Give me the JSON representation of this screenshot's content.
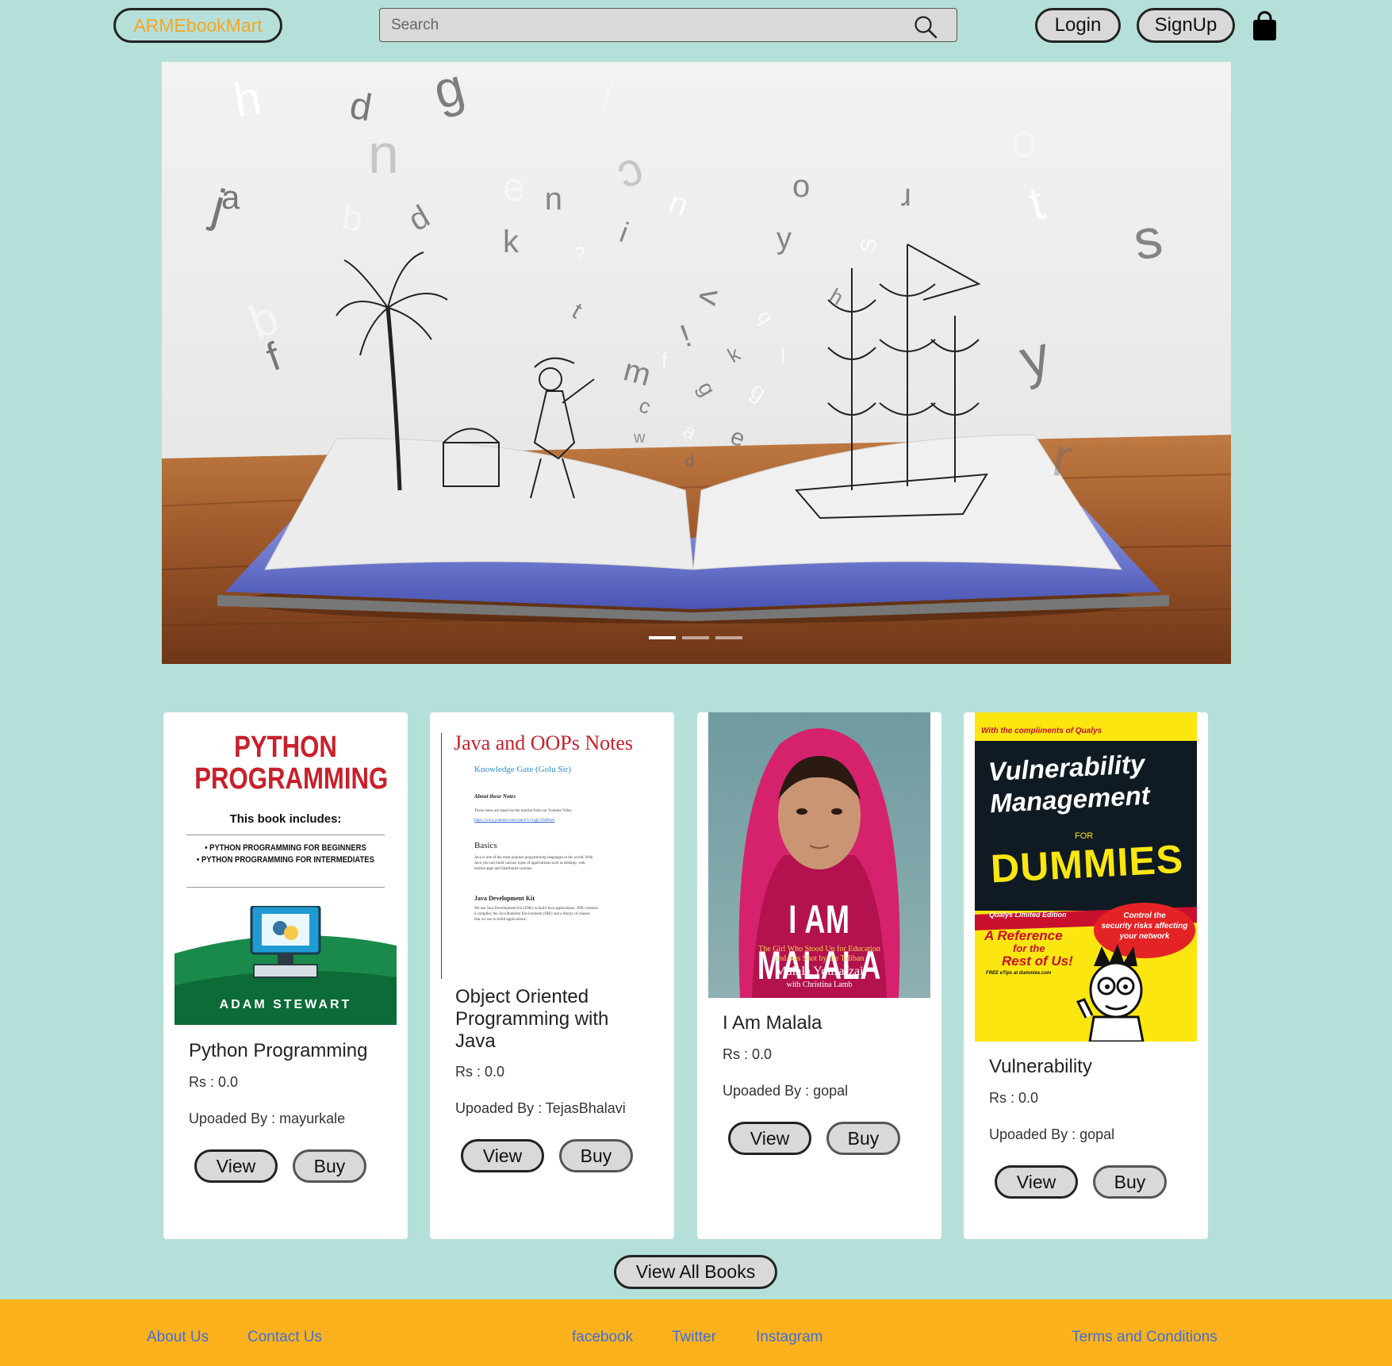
{
  "navbar": {
    "brand": "ARMEbookMart",
    "search_placeholder": "Search",
    "login": "Login",
    "signup": "SignUp"
  },
  "hero": {
    "letters": [
      "h",
      "d",
      "g",
      "i",
      "j",
      "a",
      "b",
      "n",
      "p",
      "e",
      "u",
      "c",
      "u",
      "o",
      "r",
      "t",
      "s",
      "k",
      "?",
      "i",
      "y",
      "s",
      "v",
      "t",
      "q",
      "h",
      "m",
      "f",
      "!",
      "k",
      "l",
      "g",
      "c",
      "g",
      "y",
      "w",
      "a",
      "e",
      "d",
      "b",
      "f",
      "r",
      "o"
    ],
    "active_slide": 1,
    "slide_count": 3
  },
  "books": [
    {
      "title": "Python Programming",
      "price": "Rs : 0.0",
      "uploader": "Upoaded By : mayurkale",
      "view": "View",
      "buy": "Buy",
      "cover": {
        "title_line1": "PYTHON",
        "title_line2": "PROGRAMMING",
        "includes": "This book includes:",
        "item1": "• PYTHON PROGRAMMING FOR BEGINNERS",
        "item2": "• PYTHON PROGRAMMING FOR INTERMEDIATES",
        "author": "ADAM STEWART"
      }
    },
    {
      "title": "Object Oriented Programming with Java",
      "price": "Rs : 0.0",
      "uploader": "Upoaded By : TejasBhalavi",
      "view": "View",
      "buy": "Buy",
      "cover": {
        "heading": "Java and OOPs Notes",
        "sub": "Knowledge Gate (Golu Sir)",
        "about": "About these Notes",
        "about_text": "These notes are based on the tutorial from our Youtube Video",
        "link": "https://www.youtube.com/watch?v=1qjL5NsBhsA",
        "basics": "Basics",
        "basics_text1": "Java is one of the most popular programming languages in the world. With",
        "basics_text2": "Java you can build various types of applications such as desktop, web,",
        "basics_text3": "mobile apps and distributed systems.",
        "jdk": "Java Development Kit",
        "jdk_text1": "We use Java Development Kit (JDK) to build Java applications. JDK contains",
        "jdk_text2": "a compiler, the Java Runtime Environment (JRE) and a library of classes",
        "jdk_text3": "that we use to build applications."
      }
    },
    {
      "title": "I Am Malala",
      "price": "Rs : 0.0",
      "uploader": "Upoaded By : gopal",
      "view": "View",
      "buy": "Buy",
      "cover": {
        "title": "I AM MALALA",
        "sub1": "The Girl Who Stood Up for Education",
        "sub2": "and was Shot by the Taliban",
        "author": "Malala Yousafzai",
        "coauthor": "with Christina Lamb"
      }
    },
    {
      "title": "Vulnerability",
      "price": "Rs : 0.0",
      "uploader": "Upoaded By : gopal",
      "view": "View",
      "buy": "Buy",
      "cover": {
        "compliments": "With the compliments of Qualys",
        "title1": "Vulnerability",
        "title2": "Management",
        "for": "FOR",
        "dummies": "DUMMIES",
        "edition": "Qualys Limited Edition",
        "bubble1": "Control the",
        "bubble2": "security risks affecting",
        "bubble3": "your network",
        "ref1": "A Reference",
        "ref2": "for the",
        "ref3": "Rest of Us!",
        "tips": "FREE eTips at dummies.com"
      }
    }
  ],
  "view_all": "View All Books",
  "footer": {
    "about": "About Us",
    "contact": "Contact Us",
    "facebook": "facebook",
    "twitter": "Twitter",
    "instagram": "Instagram",
    "terms": "Terms and Conditions"
  },
  "colors": {
    "background": "#b5e0d9",
    "brand_text": "#f5a623",
    "footer": "#fdb21d",
    "footer_link": "#3f6fd6"
  }
}
